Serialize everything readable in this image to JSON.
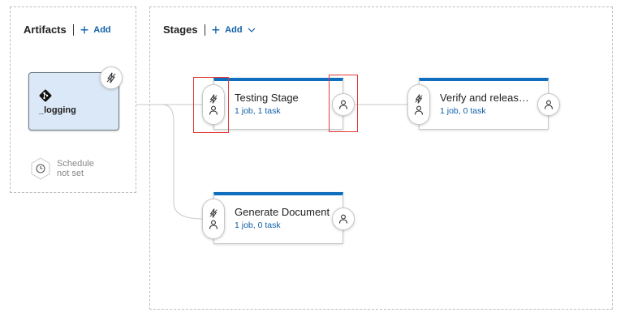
{
  "artifacts": {
    "title": "Artifacts",
    "add_label": "Add",
    "artifact_name": "_logging",
    "schedule_line1": "Schedule",
    "schedule_line2": "not set"
  },
  "stages": {
    "title": "Stages",
    "add_label": "Add",
    "items": [
      {
        "name": "Testing Stage",
        "summary": "1 job, 1 task"
      },
      {
        "name": "Verify and releas…",
        "summary": "1 job, 0 task"
      },
      {
        "name": "Generate Document",
        "summary": "1 job, 0 task"
      }
    ]
  },
  "icons": {
    "add": "plus-icon",
    "dropdown": "chevron-down-icon",
    "artifact_source": "git-icon",
    "trigger": "lightning-icon",
    "approvals": "person-icon",
    "schedule": "clock-icon"
  },
  "colors": {
    "accent": "#106ebe",
    "link": "#0f5fa8",
    "artifact_card_bg": "#dbe8f7",
    "git_icon": "#111111",
    "highlight": "#e23a3a"
  }
}
